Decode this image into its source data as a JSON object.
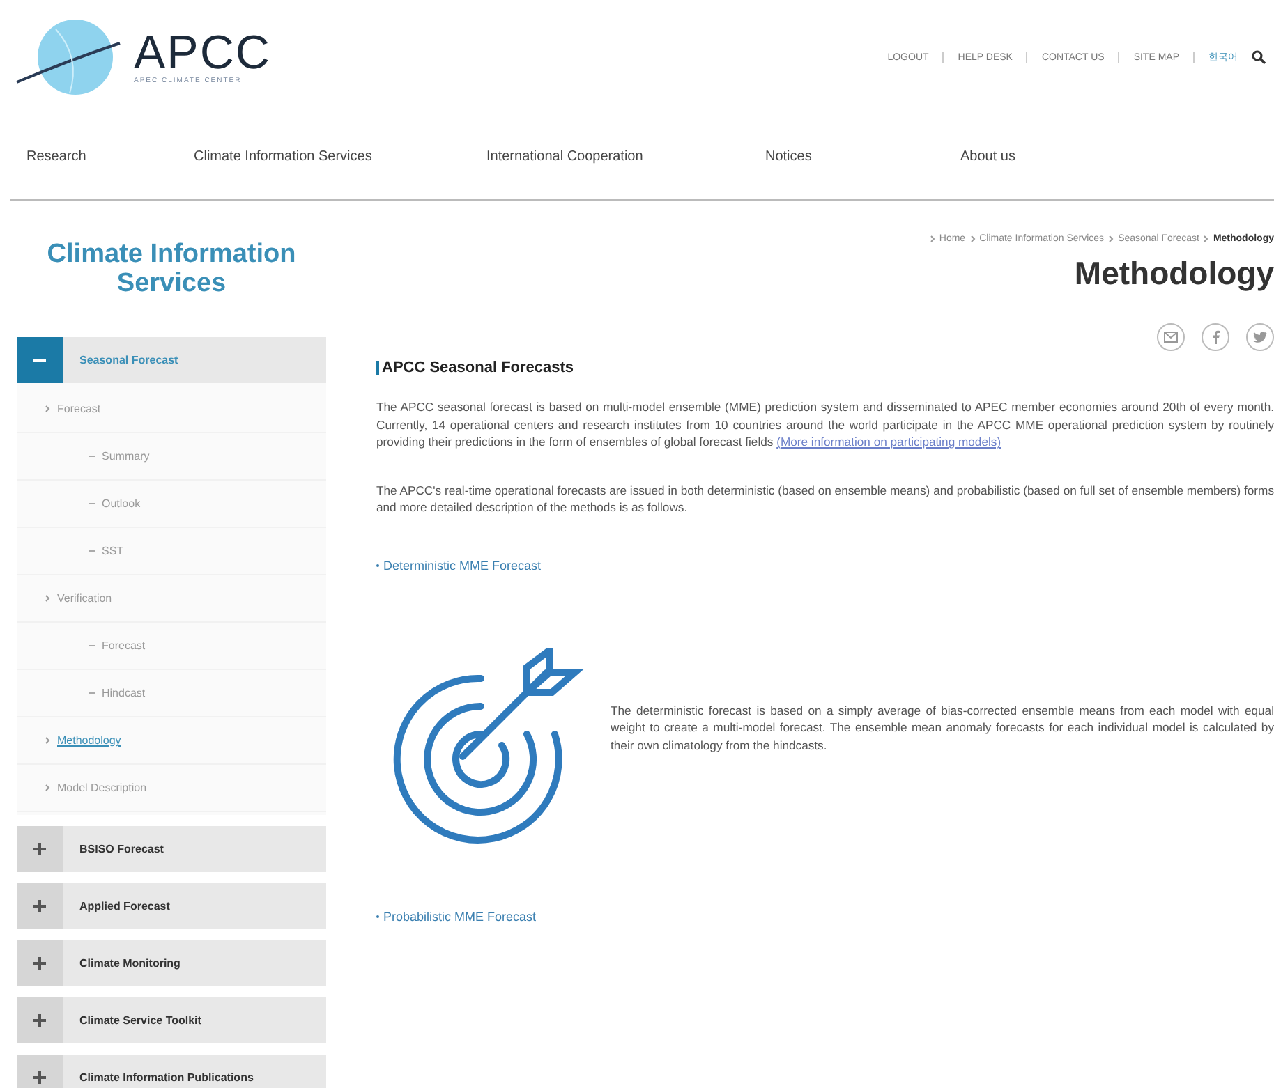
{
  "logo": {
    "name": "APCC",
    "tagline": "APEC CLIMATE CENTER"
  },
  "utility_links": [
    {
      "label": "LOGOUT",
      "kind": "link"
    },
    {
      "label": "HELP DESK",
      "kind": "link"
    },
    {
      "label": "CONTACT US",
      "kind": "link"
    },
    {
      "label": "SITE MAP",
      "kind": "link"
    },
    {
      "label": "한국어",
      "kind": "lang"
    }
  ],
  "main_nav": [
    {
      "label": "Research"
    },
    {
      "label": "Climate Information Services"
    },
    {
      "label": "International Cooperation"
    },
    {
      "label": "Notices"
    },
    {
      "label": "About us"
    }
  ],
  "sidebar": {
    "title": "Climate Information Services",
    "groups": [
      {
        "label": "Seasonal Forecast",
        "expanded": true,
        "children": [
          {
            "label": "Forecast",
            "selected": false,
            "children": [
              {
                "label": "Summary",
                "selected": false
              },
              {
                "label": "Outlook",
                "selected": false
              },
              {
                "label": "SST",
                "selected": false
              }
            ]
          },
          {
            "label": "Verification",
            "selected": false,
            "children": [
              {
                "label": "Forecast",
                "selected": false
              },
              {
                "label": "Hindcast",
                "selected": false
              }
            ]
          },
          {
            "label": "Methodology",
            "selected": true
          },
          {
            "label": "Model Description",
            "selected": false
          }
        ]
      },
      {
        "label": "BSISO Forecast",
        "expanded": false
      },
      {
        "label": "Applied Forecast",
        "expanded": false
      },
      {
        "label": "Climate Monitoring",
        "expanded": false
      },
      {
        "label": "Climate Service Toolkit",
        "expanded": false
      },
      {
        "label": "Climate Information Publications",
        "expanded": false
      }
    ]
  },
  "breadcrumb": [
    "Home",
    "Climate Information Services",
    "Seasonal Forecast",
    "Methodology"
  ],
  "page_title": "Methodology",
  "share": [
    {
      "kind": "email"
    },
    {
      "kind": "facebook"
    },
    {
      "kind": "twitter"
    }
  ],
  "section_heading": "APCC Seasonal Forecasts",
  "intro": {
    "text": "The APCC seasonal forecast is based on multi-model ensemble (MME) prediction system and disseminated to APEC member economies around 20th of every month. Currently, 14 operational centers and research institutes from 10 countries around the world participate in the APCC MME operational prediction system by routinely providing their predictions in the form of ensembles of global forecast fields",
    "link": "(More information on participating models)"
  },
  "intro_2": "The APCC's real-time operational forecasts are issued in both deterministic (based on ensemble means) and probabilistic (based on full set of ensemble members) forms and more detailed description of the methods is as follows.",
  "subsections": [
    {
      "heading": "Deterministic MME Forecast",
      "text": "The deterministic forecast is based on a simply average of bias-corrected ensemble means from each model with equal weight to create a multi-model forecast. The ensemble mean anomaly forecasts for each individual model is calculated by their own climatology from the hindcasts."
    },
    {
      "heading": "Probabilistic MME Forecast"
    }
  ]
}
